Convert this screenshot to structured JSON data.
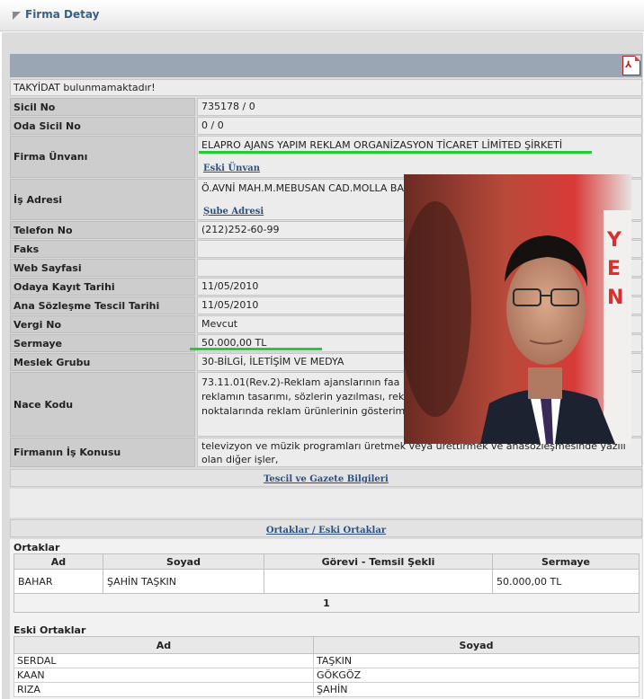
{
  "header": {
    "title": "Firma Detay"
  },
  "notice": "TAKYİDAT bulunmamaktadır!",
  "fields": [
    {
      "label": "Sicil No",
      "value": "735178 / 0"
    },
    {
      "label": "Oda Sicil No",
      "value": "0 / 0"
    },
    {
      "label": "Firma Ünvanı",
      "value": "ELAPRO AJANS YAPIM REKLAM ORGANİZASYON TİCARET LİMİTED ŞİRKETİ",
      "link": "Eski Ünvan"
    },
    {
      "label": "İş Adresi",
      "value": "Ö.AVNİ MAH.M.MEBUSAN CAD.MOLLA BA",
      "link": "Şube Adresi"
    },
    {
      "label": "Telefon No",
      "value": "(212)252-60-99"
    },
    {
      "label": "Faks",
      "value": ""
    },
    {
      "label": "Web Sayfasi",
      "value": ""
    },
    {
      "label": "Odaya Kayıt Tarihi",
      "value": "11/05/2010"
    },
    {
      "label": "Ana Sözleşme Tescil Tarihi",
      "value": "11/05/2010"
    },
    {
      "label": "Vergi No",
      "value": "Mevcut"
    },
    {
      "label": "Sermaye",
      "value": "50.000,00 TL"
    },
    {
      "label": "Meslek Grubu",
      "value": "30-BİLGİ, İLETİŞİM VE MEDYA"
    },
    {
      "label": "Nace Kodu",
      "value_lines": [
        "73.11.01(Rev.2)-Reklam ajanslarının faa",
        "reklamın tasarımı, sözlerin yazılması, rek",
        "noktalarında reklam ürünlerinin gösterim"
      ]
    },
    {
      "label": "Firmanın İş Konusu",
      "value_lines": [
        "televizyon ve müzik programları üretmek veya ürettirmek ve anasözleşmesinde yazılı",
        "olan diğer işler,"
      ]
    }
  ],
  "links": {
    "tescil": "Tescil ve Gazete Bilgileri",
    "ortaklar": "Ortaklar / Eski Ortaklar"
  },
  "partners": {
    "title": "Ortaklar",
    "columns": [
      "Ad",
      "Soyad",
      "Görevi - Temsil Şekli",
      "Sermaye"
    ],
    "rows": [
      [
        "BAHAR",
        "ŞAHİN TAŞKIN",
        "",
        "50.000,00 TL"
      ]
    ],
    "page": "1"
  },
  "former_partners": {
    "title": "Eski Ortaklar",
    "columns": [
      "Ad",
      "Soyad"
    ],
    "rows": [
      [
        "SERDAL",
        "TAŞKIN"
      ],
      [
        "KAAN",
        "GÖKGÖZ"
      ],
      [
        "RIZA",
        "ŞAHİN"
      ]
    ]
  },
  "colors": {
    "highlight_underline": "#22cc33",
    "label_bg": "#cdcdcd",
    "link": "#2c4f82"
  },
  "icons": {
    "pdf": "pdf-icon"
  }
}
